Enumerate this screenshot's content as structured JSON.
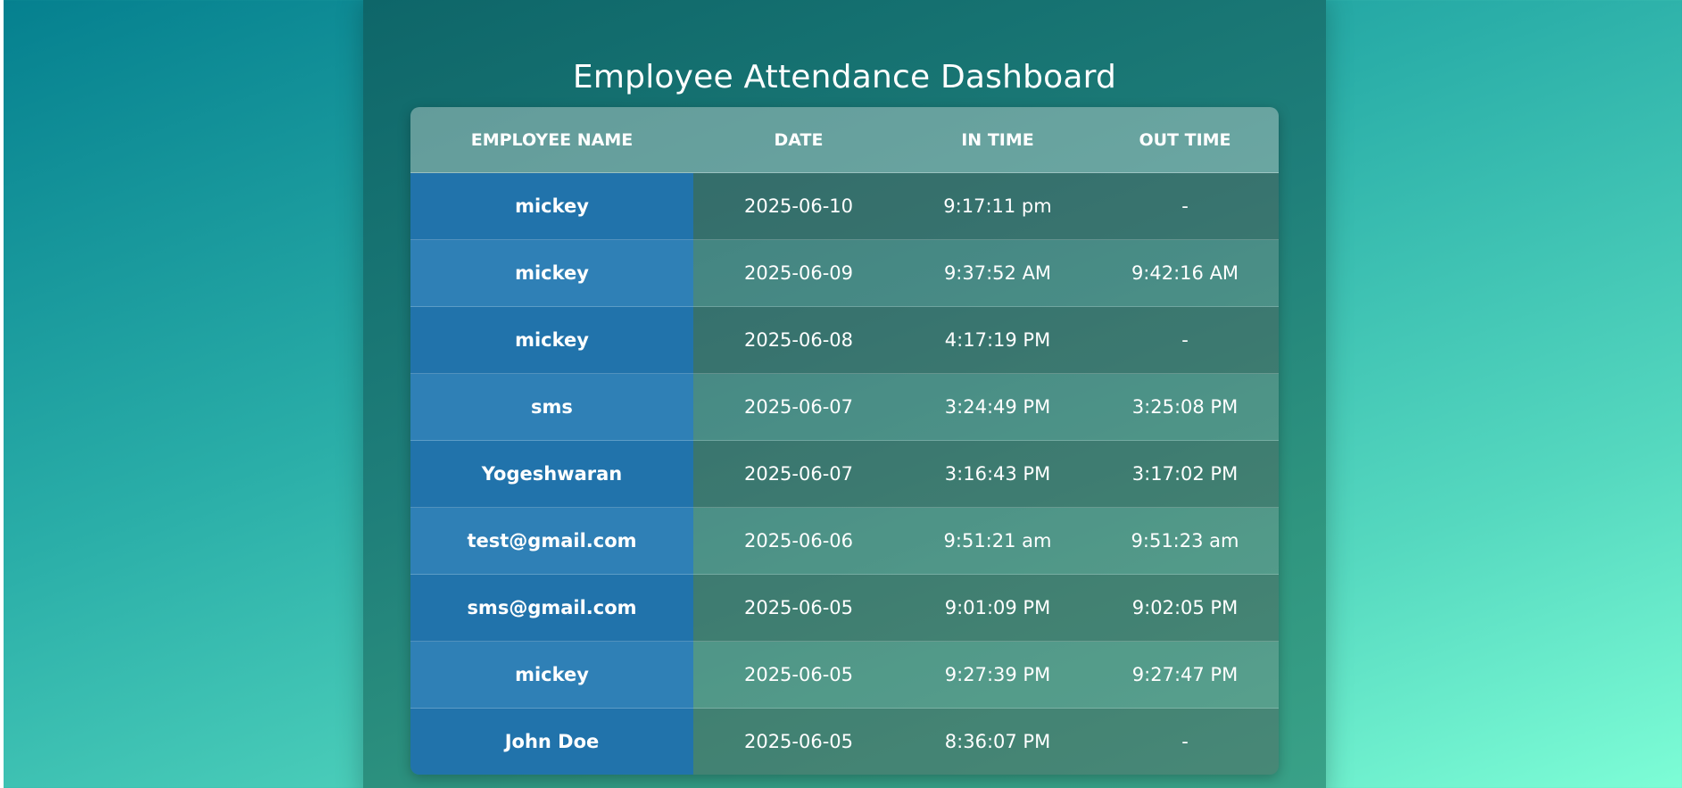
{
  "page": {
    "title": "Employee Attendance Dashboard"
  },
  "table": {
    "headers": {
      "name": "Employee Name",
      "date": "Date",
      "in_time": "In Time",
      "out_time": "Out Time"
    },
    "rows": [
      {
        "name": "mickey",
        "date": "2025-06-10",
        "in_time": "9:17:11 pm",
        "out_time": "-"
      },
      {
        "name": "mickey",
        "date": "2025-06-09",
        "in_time": "9:37:52 AM",
        "out_time": "9:42:16 AM"
      },
      {
        "name": "mickey",
        "date": "2025-06-08",
        "in_time": "4:17:19 PM",
        "out_time": "-"
      },
      {
        "name": "sms",
        "date": "2025-06-07",
        "in_time": "3:24:49 PM",
        "out_time": "3:25:08 PM"
      },
      {
        "name": "Yogeshwaran",
        "date": "2025-06-07",
        "in_time": "3:16:43 PM",
        "out_time": "3:17:02 PM"
      },
      {
        "name": "test@gmail.com",
        "date": "2025-06-06",
        "in_time": "9:51:21 am",
        "out_time": "9:51:23 am"
      },
      {
        "name": "sms@gmail.com",
        "date": "2025-06-05",
        "in_time": "9:01:09 PM",
        "out_time": "9:02:05 PM"
      },
      {
        "name": "mickey",
        "date": "2025-06-05",
        "in_time": "9:27:39 PM",
        "out_time": "9:27:47 PM"
      },
      {
        "name": "John Doe",
        "date": "2025-06-05",
        "in_time": "8:36:07 PM",
        "out_time": "-"
      }
    ]
  },
  "colors": {
    "name_column": "#2173ab",
    "name_column_alt": "#2f80b6",
    "text": "#ffffff"
  }
}
